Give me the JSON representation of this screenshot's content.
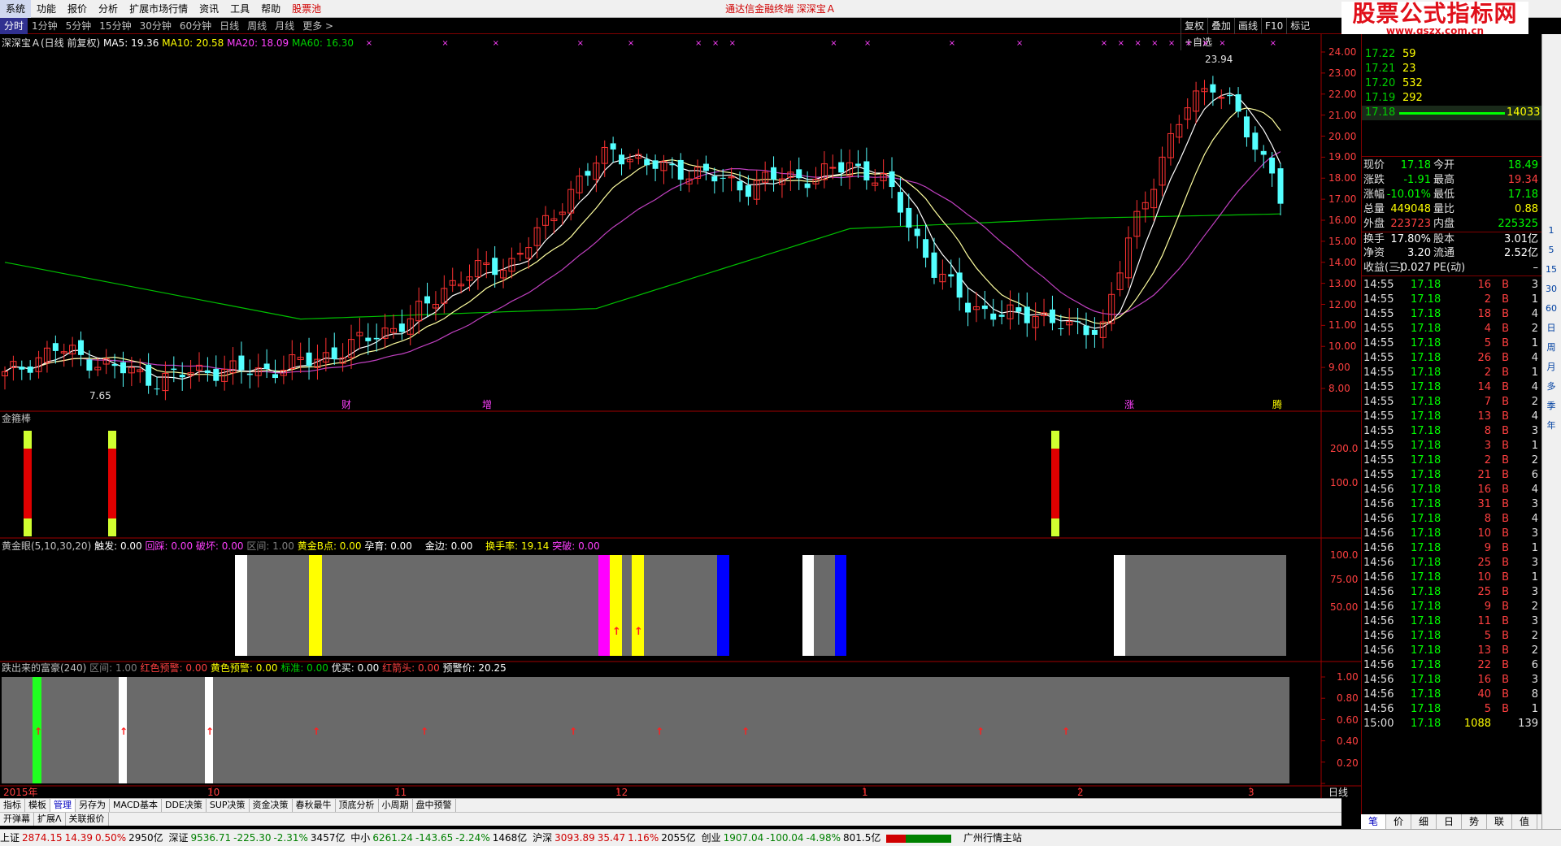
{
  "menu": {
    "items": [
      "系统",
      "功能",
      "报价",
      "分析",
      "扩展市场行情",
      "资讯",
      "工具",
      "帮助",
      "股票池"
    ],
    "center_title": "通达信金融终端   深深宝Ａ"
  },
  "logo": {
    "line1": "股票公式指标网",
    "line2": "www.gszx.com.cn"
  },
  "periods": [
    "分时",
    "1分钟",
    "5分钟",
    "15分钟",
    "30分钟",
    "60分钟",
    "日线",
    "周线",
    "月线",
    "更多 >"
  ],
  "right_tools": [
    "复权",
    "叠加",
    "画线",
    "F10",
    "标记",
    "+自选"
  ],
  "main_chart": {
    "title": "深深宝Ａ(日线 前复权)",
    "ma": [
      {
        "label": "MA5: 19.36",
        "color": "#ffffff"
      },
      {
        "label": "MA10: 20.58",
        "color": "#ffff00"
      },
      {
        "label": "MA20: 18.09",
        "color": "#ff40ff"
      },
      {
        "label": "MA60: 16.30",
        "color": "#00ff00"
      }
    ],
    "y_ticks": [
      "24.00",
      "23.00",
      "22.00",
      "21.00",
      "20.00",
      "19.00",
      "18.00",
      "17.00",
      "16.00",
      "15.00",
      "14.00",
      "13.00",
      "12.00",
      "11.00",
      "10.00",
      "9.00",
      "8.00"
    ],
    "high_label": "23.94",
    "low_label": "7.65",
    "events": [
      "财",
      "增",
      "涨",
      "腾"
    ]
  },
  "jinjiebang": {
    "title": "金箍棒",
    "y_ticks": [
      "200.0",
      "100.0"
    ]
  },
  "golden_eye": {
    "parts": [
      {
        "t": "黄金眼(5,10,30,20)",
        "c": "#c0c0c0"
      },
      {
        "t": "触发: 0.00",
        "c": "#ffffff"
      },
      {
        "t": "回踩: 0.00",
        "c": "#ff40ff"
      },
      {
        "t": "破坏: 0.00",
        "c": "#ff40ff"
      },
      {
        "t": "区间: 1.00",
        "c": "#808080"
      },
      {
        "t": "黄金B点: 0.00",
        "c": "#ffff00"
      },
      {
        "t": "孕育: 0.00",
        "c": "#ffffff"
      },
      {
        "t": "金边: 0.00",
        "c": "#ffffff"
      },
      {
        "t": "换手率: 19.14",
        "c": "#ffff00"
      },
      {
        "t": "突破: 0.00",
        "c": "#ff40ff"
      }
    ],
    "y_ticks": [
      "100.0",
      "75.00",
      "50.00"
    ]
  },
  "fortune": {
    "parts": [
      {
        "t": "跌出来的富豪(240)",
        "c": "#c0c0c0"
      },
      {
        "t": "区间: 1.00",
        "c": "#808080"
      },
      {
        "t": "红色预警: 0.00",
        "c": "#ff4040"
      },
      {
        "t": "黄色预警: 0.00",
        "c": "#ffff00"
      },
      {
        "t": "标准: 0.00",
        "c": "#00d000"
      },
      {
        "t": "优买: 0.00",
        "c": "#ffffff"
      },
      {
        "t": "红箭头: 0.00",
        "c": "#ff4040"
      },
      {
        "t": "预警价: 20.25",
        "c": "#ffffff"
      }
    ],
    "y_ticks": [
      "1.00",
      "0.80",
      "0.60",
      "0.40",
      "0.20"
    ]
  },
  "x_axis": {
    "year_label": "2015年",
    "months": [
      "10",
      "11",
      "12",
      "1",
      "2",
      "3"
    ],
    "period_label": "日线"
  },
  "quote": {
    "asks": [
      {
        "p": "17.22",
        "v": "59"
      },
      {
        "p": "17.21",
        "v": "23"
      },
      {
        "p": "17.20",
        "v": "532"
      },
      {
        "p": "17.19",
        "v": "292"
      }
    ],
    "bid_price": "17.18",
    "bid_vol": "14033",
    "stats": [
      {
        "l1": "现价",
        "v1": "17.18",
        "c1": "#00ff00",
        "l2": "今开",
        "v2": "18.49",
        "c2": "#00ff00"
      },
      {
        "l1": "涨跌",
        "v1": "-1.91",
        "c1": "#00ff00",
        "l2": "最高",
        "v2": "19.34",
        "c2": "#ff4040"
      },
      {
        "l1": "涨幅",
        "v1": "-10.01%",
        "c1": "#00ff00",
        "l2": "最低",
        "v2": "17.18",
        "c2": "#00ff00"
      },
      {
        "l1": "总量",
        "v1": "449048",
        "c1": "#ffff00",
        "l2": "量比",
        "v2": "0.88",
        "c2": "#ffff00"
      },
      {
        "l1": "外盘",
        "v1": "223723",
        "c1": "#ff4040",
        "l2": "内盘",
        "v2": "225325",
        "c2": "#00ff00"
      },
      {
        "l1": "换手",
        "v1": "17.80%",
        "c1": "#ffffff",
        "l2": "股本",
        "v2": "3.01亿",
        "c2": "#ffffff"
      },
      {
        "l1": "净资",
        "v1": "3.20",
        "c1": "#ffffff",
        "l2": "流通",
        "v2": "2.52亿",
        "c2": "#ffffff"
      },
      {
        "l1": "收益(三)",
        "v1": "-0.027",
        "c1": "#ffffff",
        "l2": "PE(动)",
        "v2": "–",
        "c2": "#ffffff"
      }
    ],
    "ticks": [
      {
        "t": "14:55",
        "p": "17.18",
        "v": "16",
        "s": "B",
        "n": "3"
      },
      {
        "t": "14:55",
        "p": "17.18",
        "v": "2",
        "s": "B",
        "n": "1"
      },
      {
        "t": "14:55",
        "p": "17.18",
        "v": "18",
        "s": "B",
        "n": "4"
      },
      {
        "t": "14:55",
        "p": "17.18",
        "v": "4",
        "s": "B",
        "n": "2"
      },
      {
        "t": "14:55",
        "p": "17.18",
        "v": "5",
        "s": "B",
        "n": "1"
      },
      {
        "t": "14:55",
        "p": "17.18",
        "v": "26",
        "s": "B",
        "n": "4"
      },
      {
        "t": "14:55",
        "p": "17.18",
        "v": "2",
        "s": "B",
        "n": "1"
      },
      {
        "t": "14:55",
        "p": "17.18",
        "v": "14",
        "s": "B",
        "n": "4"
      },
      {
        "t": "14:55",
        "p": "17.18",
        "v": "7",
        "s": "B",
        "n": "2"
      },
      {
        "t": "14:55",
        "p": "17.18",
        "v": "13",
        "s": "B",
        "n": "4"
      },
      {
        "t": "14:55",
        "p": "17.18",
        "v": "8",
        "s": "B",
        "n": "3"
      },
      {
        "t": "14:55",
        "p": "17.18",
        "v": "3",
        "s": "B",
        "n": "1"
      },
      {
        "t": "14:55",
        "p": "17.18",
        "v": "2",
        "s": "B",
        "n": "2"
      },
      {
        "t": "14:55",
        "p": "17.18",
        "v": "21",
        "s": "B",
        "n": "6"
      },
      {
        "t": "14:56",
        "p": "17.18",
        "v": "16",
        "s": "B",
        "n": "4"
      },
      {
        "t": "14:56",
        "p": "17.18",
        "v": "31",
        "s": "B",
        "n": "3"
      },
      {
        "t": "14:56",
        "p": "17.18",
        "v": "8",
        "s": "B",
        "n": "4"
      },
      {
        "t": "14:56",
        "p": "17.18",
        "v": "10",
        "s": "B",
        "n": "3"
      },
      {
        "t": "14:56",
        "p": "17.18",
        "v": "9",
        "s": "B",
        "n": "1"
      },
      {
        "t": "14:56",
        "p": "17.18",
        "v": "25",
        "s": "B",
        "n": "3"
      },
      {
        "t": "14:56",
        "p": "17.18",
        "v": "10",
        "s": "B",
        "n": "1"
      },
      {
        "t": "14:56",
        "p": "17.18",
        "v": "25",
        "s": "B",
        "n": "3"
      },
      {
        "t": "14:56",
        "p": "17.18",
        "v": "9",
        "s": "B",
        "n": "2"
      },
      {
        "t": "14:56",
        "p": "17.18",
        "v": "11",
        "s": "B",
        "n": "3"
      },
      {
        "t": "14:56",
        "p": "17.18",
        "v": "5",
        "s": "B",
        "n": "2"
      },
      {
        "t": "14:56",
        "p": "17.18",
        "v": "13",
        "s": "B",
        "n": "2"
      },
      {
        "t": "14:56",
        "p": "17.18",
        "v": "22",
        "s": "B",
        "n": "6"
      },
      {
        "t": "14:56",
        "p": "17.18",
        "v": "16",
        "s": "B",
        "n": "3"
      },
      {
        "t": "14:56",
        "p": "17.18",
        "v": "40",
        "s": "B",
        "n": "8"
      },
      {
        "t": "14:56",
        "p": "17.18",
        "v": "5",
        "s": "B",
        "n": "1"
      },
      {
        "t": "15:00",
        "p": "17.18",
        "v": "1088",
        "s": "",
        "n": "139"
      }
    ]
  },
  "side_toolbar": [
    "1",
    "5",
    "15",
    "30",
    "60",
    "日",
    "周",
    "月",
    "多",
    "季",
    "年"
  ],
  "bottom_tabs": [
    "指标",
    "模板",
    "管理",
    "另存为",
    "MACD基本",
    "DDE决策",
    "SUP决策",
    "资金决策",
    "春秋最牛",
    "顶底分析",
    "小周期",
    "盘中预警"
  ],
  "bottom_tabs2": [
    "开弹幕",
    "扩展Λ",
    "关联报价"
  ],
  "right_tabs": [
    "笔",
    "价",
    "细",
    "日",
    "势",
    "联",
    "值"
  ],
  "status": {
    "sh_label": "上证",
    "sh_val": "2874.15",
    "sh_chg": "14.39",
    "sh_pct": "0.50%",
    "sh_amt": "2950亿",
    "sz_label": "深证",
    "sz_val": "9536.71",
    "sz_chg": "-225.30",
    "sz_pct": "-2.31%",
    "sz_amt": "3457亿",
    "zx_label": "中小",
    "zx_val": "6261.24",
    "zx_chg": "-143.65",
    "zx_pct": "-2.24%",
    "zx_amt": "1468亿",
    "hs_label": "沪深",
    "hs_val": "3093.89",
    "hs_chg": "35.47",
    "hs_pct": "1.16%",
    "hs_amt": "2055亿",
    "cy_label": "创业",
    "cy_val": "1907.04",
    "cy_chg": "-100.04",
    "cy_pct": "-4.98%",
    "cy_amt": "801.5亿",
    "server": "广州行情主站"
  }
}
